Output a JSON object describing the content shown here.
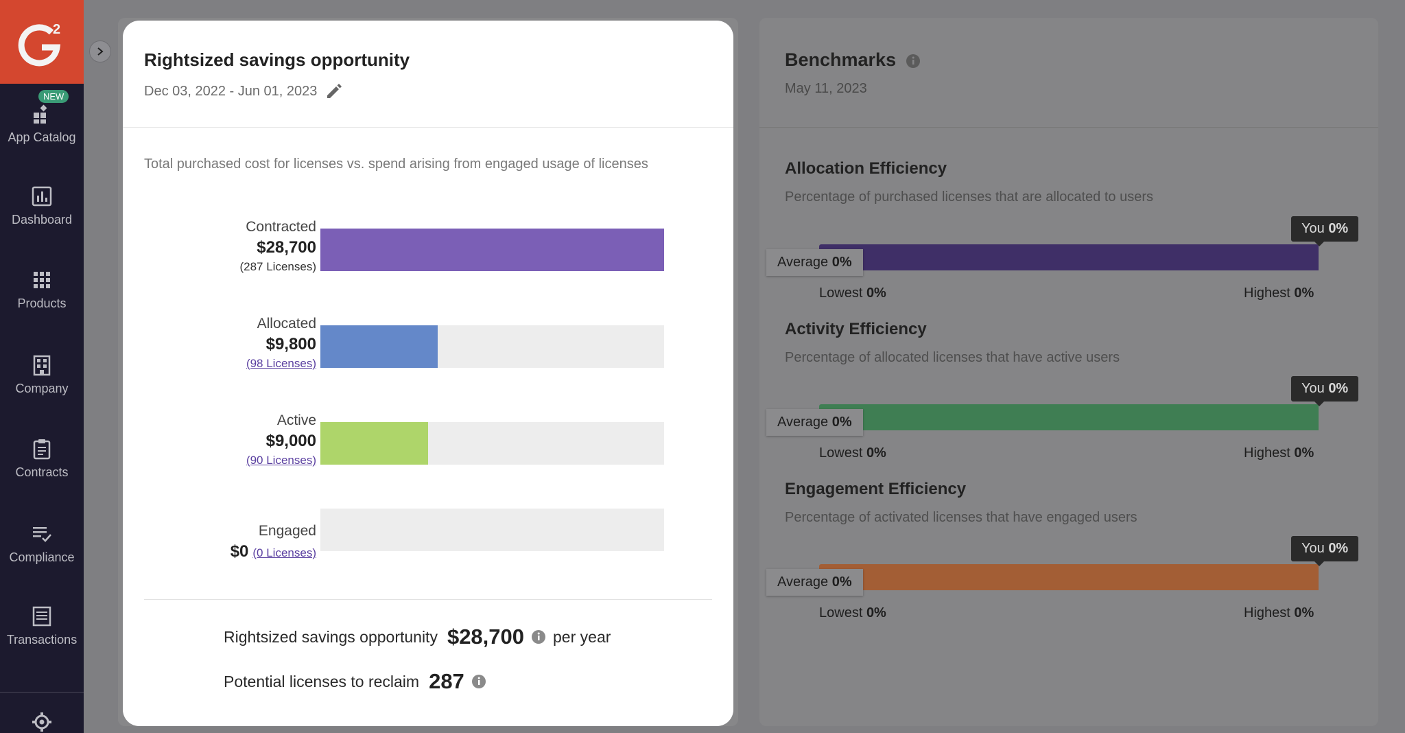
{
  "colors": {
    "sidebar_bg": "#1c1a2e",
    "logo_bg": "#d4472f",
    "contracted_bar": "#7b5fb6",
    "allocated_bar": "#6488c9",
    "active_bar": "#aed56a",
    "allocation_bar": "#3f2f67",
    "activity_bar": "#3f7e53",
    "engagement_bar": "#a35e35"
  },
  "sidebar": {
    "logo_icon": "g2-logo",
    "new_badge": "NEW",
    "items": [
      {
        "label": "App Catalog",
        "icon": "app-catalog-icon"
      },
      {
        "label": "Dashboard",
        "icon": "bar-chart-icon"
      },
      {
        "label": "Products",
        "icon": "grid-icon"
      },
      {
        "label": "Company",
        "icon": "building-icon"
      },
      {
        "label": "Contracts",
        "icon": "clipboard-icon"
      },
      {
        "label": "Compliance",
        "icon": "checklist-icon"
      },
      {
        "label": "Transactions",
        "icon": "receipt-icon"
      }
    ],
    "settings_icon": "gear-icon",
    "collapse_icon": "chevron-right-icon"
  },
  "modal": {
    "title": "Rightsized savings opportunity",
    "date_range": "Dec 03, 2022 - Jun 01, 2023",
    "subtitle": "Total purchased cost for licenses vs. spend arising from engaged usage of licenses",
    "rows": [
      {
        "label": "Contracted",
        "amount": "$28,700",
        "licenses": "(287 Licenses)",
        "fill_fraction": 1.0,
        "linked": false
      },
      {
        "label": "Allocated",
        "amount": "$9,800",
        "licenses": "(98 Licenses)",
        "fill_fraction": 0.341,
        "linked": true
      },
      {
        "label": "Active",
        "amount": "$9,000",
        "licenses": "(90 Licenses)",
        "fill_fraction": 0.314,
        "linked": true
      },
      {
        "label": "Engaged",
        "amount": "$0",
        "licenses": "(0 Licenses)",
        "fill_fraction": 0.0,
        "linked": true
      }
    ],
    "savings_label": "Rightsized savings opportunity",
    "savings_value": "$28,700",
    "savings_suffix": "per year",
    "reclaim_label": "Potential licenses to reclaim",
    "reclaim_value": "287"
  },
  "benchmarks": {
    "title": "Benchmarks",
    "date": "May 11, 2023",
    "metrics": [
      {
        "title": "Allocation Efficiency",
        "desc": "Percentage of purchased licenses that are allocated to users",
        "you_label": "You",
        "you": "0%",
        "avg_label": "Average",
        "avg": "0%",
        "lowest_label": "Lowest",
        "lowest": "0%",
        "highest_label": "Highest",
        "highest": "0%"
      },
      {
        "title": "Activity Efficiency",
        "desc": "Percentage of allocated licenses that have active users",
        "you_label": "You",
        "you": "0%",
        "avg_label": "Average",
        "avg": "0%",
        "lowest_label": "Lowest",
        "lowest": "0%",
        "highest_label": "Highest",
        "highest": "0%"
      },
      {
        "title": "Engagement Efficiency",
        "desc": "Percentage of activated licenses that have engaged users",
        "you_label": "You",
        "you": "0%",
        "avg_label": "Average",
        "avg": "0%",
        "lowest_label": "Lowest",
        "lowest": "0%",
        "highest_label": "Highest",
        "highest": "0%"
      }
    ]
  }
}
